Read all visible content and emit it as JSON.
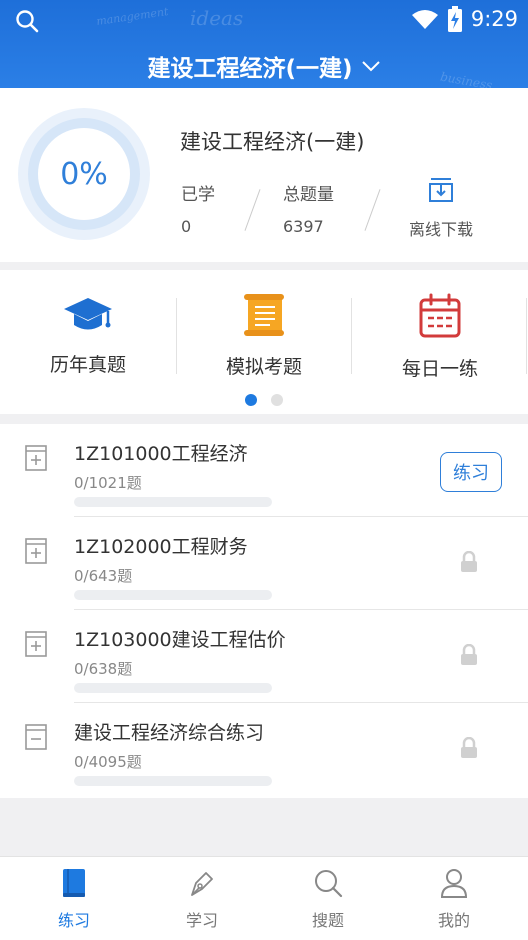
{
  "status_bar": {
    "time": "9:29"
  },
  "header": {
    "title": "建设工程经济(一建)",
    "doodles": [
      "ideas",
      "management",
      "business"
    ]
  },
  "progress": {
    "percent_text": "0%",
    "percent": 0,
    "subject_name": "建设工程经济(一建)",
    "learned_label": "已学",
    "learned_value": "0",
    "total_label": "总题量",
    "total_value": "6397",
    "download_label": "离线下载"
  },
  "categories": [
    {
      "label": "历年真题",
      "icon": "graduation-cap-icon"
    },
    {
      "label": "模拟考题",
      "icon": "scroll-icon"
    },
    {
      "label": "每日一练",
      "icon": "calendar-icon"
    }
  ],
  "carousel": {
    "pages": 2,
    "active": 0
  },
  "chapters": [
    {
      "title": "1Z101000工程经济",
      "count": "0/1021题",
      "progress": 0,
      "state": "unlocked",
      "icon": "expand-plus-icon",
      "action_label": "练习"
    },
    {
      "title": "1Z102000工程财务",
      "count": "0/643题",
      "progress": 0,
      "state": "locked",
      "icon": "expand-plus-icon"
    },
    {
      "title": "1Z103000建设工程估价",
      "count": "0/638题",
      "progress": 0,
      "state": "locked",
      "icon": "expand-plus-icon"
    },
    {
      "title": "建设工程经济综合练习",
      "count": "0/4095题",
      "progress": 0,
      "state": "locked",
      "icon": "collapse-minus-icon"
    }
  ],
  "nav": [
    {
      "label": "练习",
      "icon": "book-icon",
      "active": true
    },
    {
      "label": "学习",
      "icon": "pen-icon",
      "active": false
    },
    {
      "label": "搜题",
      "icon": "search-icon",
      "active": false
    },
    {
      "label": "我的",
      "icon": "user-icon",
      "active": false
    }
  ],
  "colors": {
    "primary": "#1e7ae0",
    "header": "#2b7fe6",
    "background": "#f0f0f2"
  }
}
